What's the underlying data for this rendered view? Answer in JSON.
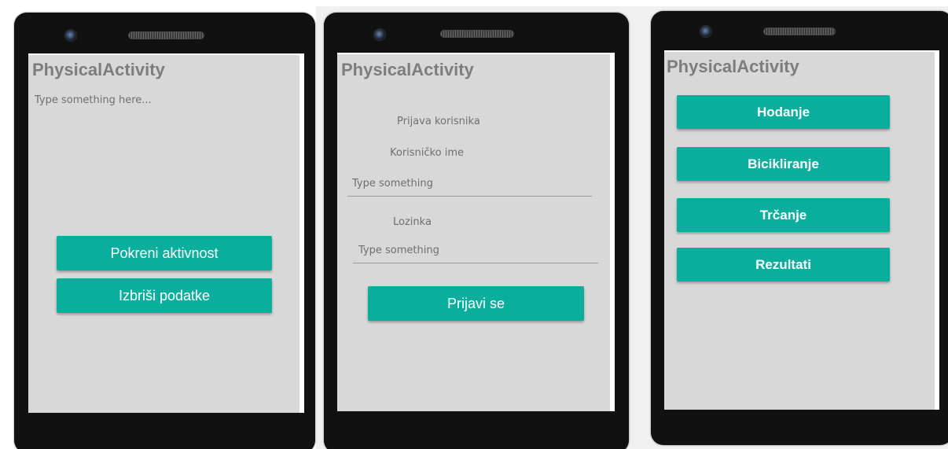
{
  "colors": {
    "accent": "#0aae9d",
    "screen_bg": "#d8d8d8",
    "phone_body": "#111111",
    "title_text": "#7d7d7d"
  },
  "screen1": {
    "app_title": "PhysicalActivity",
    "textarea_placeholder": "Type something here...",
    "start_button": "Pokreni aktivnost",
    "delete_button": "Izbriši podatke"
  },
  "screen2": {
    "app_title": "PhysicalActivity",
    "login_heading": "Prijava korisnika",
    "username_label": "Korisničko ime",
    "username_placeholder": "Type something",
    "password_label": "Lozinka",
    "password_placeholder": "Type something",
    "login_button": "Prijavi se"
  },
  "screen3": {
    "app_title": "PhysicalActivity",
    "menu": [
      {
        "label": "Hodanje"
      },
      {
        "label": "Bicikliranje"
      },
      {
        "label": "Trčanje"
      },
      {
        "label": "Rezultati"
      }
    ]
  }
}
